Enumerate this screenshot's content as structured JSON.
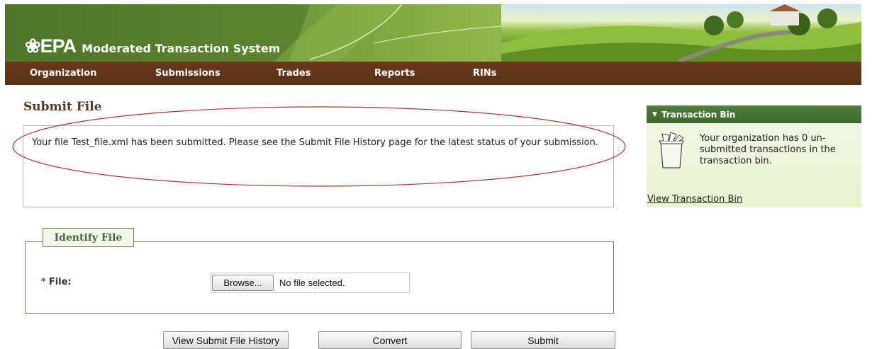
{
  "header": {
    "logo_text": "❀EPA",
    "system_name": "Moderated Transaction System"
  },
  "nav": {
    "items": [
      {
        "label": "Organization"
      },
      {
        "label": "Submissions"
      },
      {
        "label": "Trades"
      },
      {
        "label": "Reports"
      },
      {
        "label": "RINs"
      }
    ]
  },
  "main": {
    "title": "Submit File",
    "message": "Your file Test_file.xml has been submitted. Please see the Submit File History page for the latest status of your submission.",
    "identify_file": {
      "legend": "Identify File",
      "required_marker": "*",
      "file_label": "File:",
      "browse_label": "Browse...",
      "file_status": "No file selected."
    },
    "actions": {
      "history_label": "View Submit File History",
      "convert_label": "Convert",
      "submit_label": "Submit"
    }
  },
  "sidebar": {
    "header": "Transaction Bin",
    "toggle_icon": "triangle-down-icon",
    "bin_icon": "transaction-bin-icon",
    "message": "Your organization has 0 un-submitted transactions in the transaction bin.",
    "link": "View Transaction Bin"
  },
  "colors": {
    "nav_bg": "#5a2f16",
    "banner_green": "#6f9638",
    "sidebar_header": "#4f7d3a",
    "title_brown": "#5a3a1f",
    "annotation_red": "#b0322a"
  }
}
